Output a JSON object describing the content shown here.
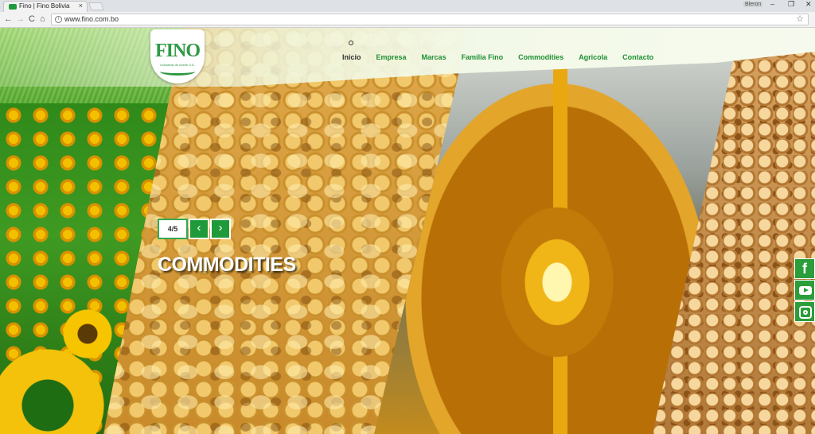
{
  "browser": {
    "tab_title": "Fino | Fino Bolivia",
    "tab_close": "×",
    "profile": "Bleron",
    "url": "www.fino.com.bo",
    "window_controls": [
      "–",
      "❐",
      "✕"
    ],
    "nav": {
      "back": "←",
      "forward": "→",
      "reload": "C",
      "home": "⌂"
    },
    "star": "☆"
  },
  "header": {
    "logo_text": "FINO",
    "logo_subtitle": "Industrias de Aceite S.A.",
    "menu": [
      {
        "label": "Inicio",
        "active": true
      },
      {
        "label": "Empresa"
      },
      {
        "label": "Marcas"
      },
      {
        "label": "Familia Fino"
      },
      {
        "label": "Commodities"
      },
      {
        "label": "Agricola"
      },
      {
        "label": "Contacto"
      }
    ]
  },
  "slider": {
    "counter": "4/5",
    "prev": "‹",
    "next": "›",
    "title": "COMMODITIES"
  },
  "social": {
    "facebook": "f",
    "youtube_icon": "youtube-icon",
    "instagram_icon": "instagram-icon"
  },
  "colors": {
    "brand_green": "#1f9a3a",
    "menu_green": "#1d8f33"
  }
}
